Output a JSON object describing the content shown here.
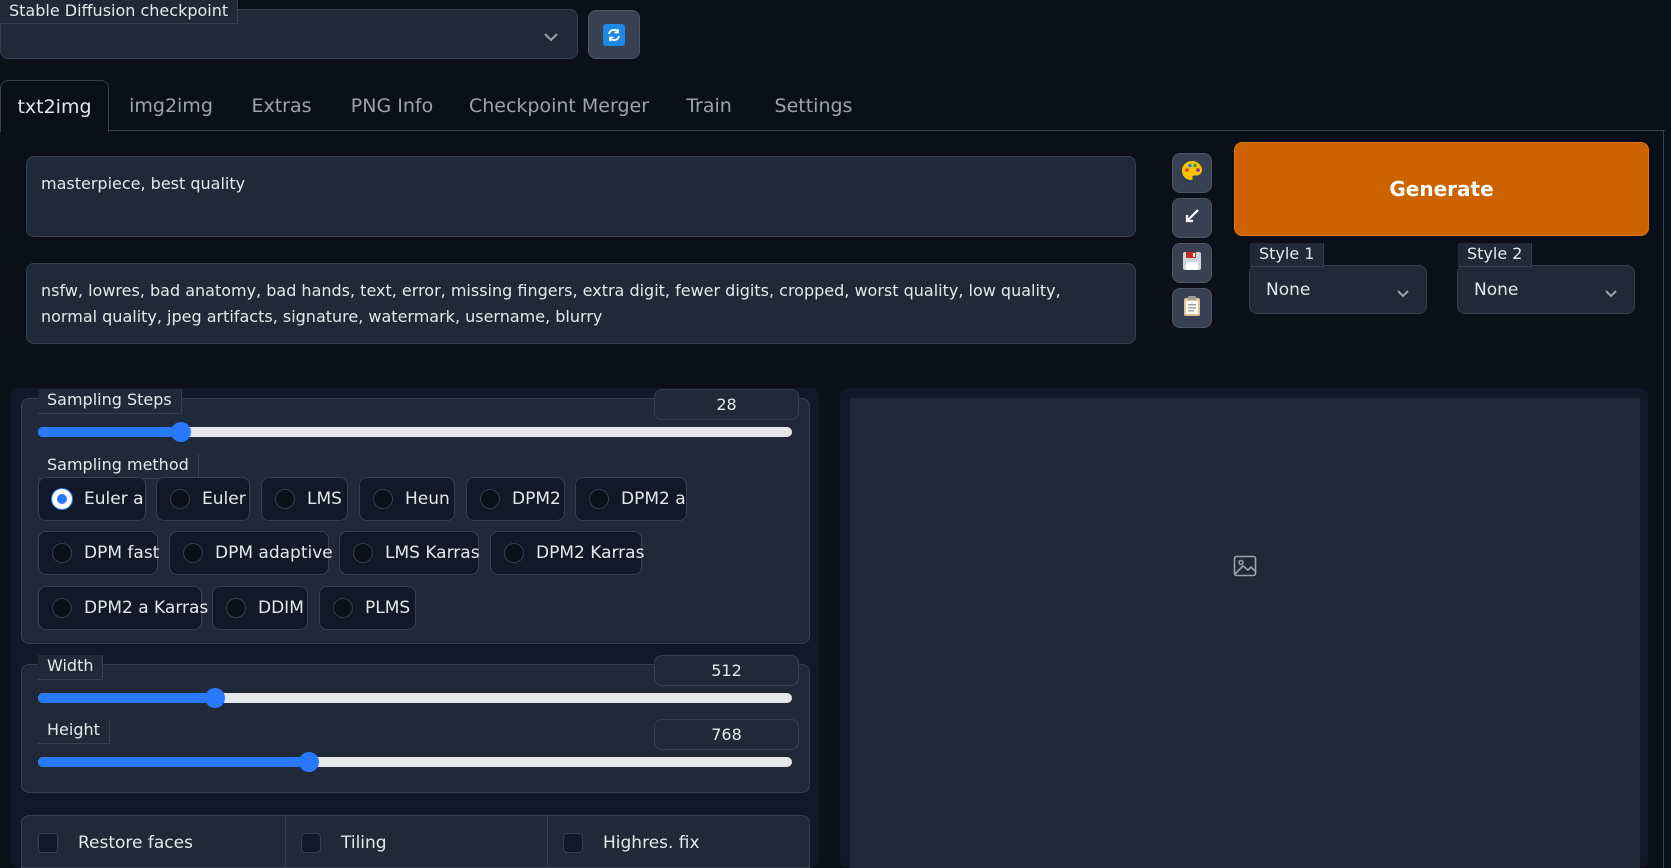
{
  "checkpoint": {
    "label": "Stable Diffusion checkpoint",
    "value": ""
  },
  "tabs": [
    {
      "label": "txt2img",
      "active": true
    },
    {
      "label": "img2img"
    },
    {
      "label": "Extras"
    },
    {
      "label": "PNG Info"
    },
    {
      "label": "Checkpoint Merger"
    },
    {
      "label": "Train"
    },
    {
      "label": "Settings"
    }
  ],
  "prompt": {
    "positive": "masterpiece, best quality",
    "negative": "nsfw, lowres, bad anatomy, bad hands, text, error, missing fingers, extra digit, fewer digits, cropped, worst quality, low quality, normal quality, jpeg artifacts, signature, watermark, username, blurry"
  },
  "tools": [
    "palette-icon",
    "arrow-icon",
    "save-icon",
    "clipboard-icon"
  ],
  "generate": {
    "label": "Generate",
    "color": "#cc6300"
  },
  "styles": [
    {
      "label": "Style 1",
      "value": "None"
    },
    {
      "label": "Style 2",
      "value": "None"
    }
  ],
  "sampling_steps": {
    "label": "Sampling Steps",
    "value": "28",
    "fraction": 0.19
  },
  "sampling_method": {
    "label": "Sampling method",
    "selected": "Euler a",
    "options": [
      "Euler a",
      "Euler",
      "LMS",
      "Heun",
      "DPM2",
      "DPM2 a",
      "DPM fast",
      "DPM adaptive",
      "LMS Karras",
      "DPM2 Karras",
      "DPM2 a Karras",
      "DDIM",
      "PLMS"
    ]
  },
  "width": {
    "label": "Width",
    "value": "512",
    "fraction": 0.235
  },
  "height": {
    "label": "Height",
    "value": "768",
    "fraction": 0.36
  },
  "checkboxes": [
    {
      "label": "Restore faces",
      "checked": false
    },
    {
      "label": "Tiling",
      "checked": false
    },
    {
      "label": "Highres. fix",
      "checked": false
    }
  ],
  "accent_color": "#2979ff"
}
